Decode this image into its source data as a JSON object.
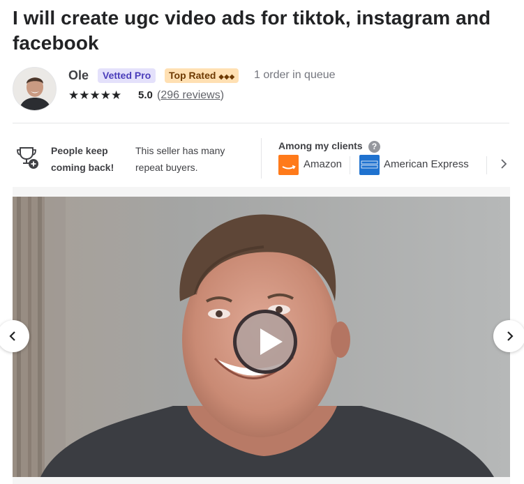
{
  "gig": {
    "title": "I will create ugc video ads for tiktok, instagram and facebook"
  },
  "seller": {
    "name": "Ole",
    "badge_vetted": "Vetted Pro",
    "badge_top_rated": "Top Rated",
    "badge_top_rated_suffix": "◆◆◆",
    "queue": "1 order in queue",
    "stars_icon": "★★★★★",
    "rating": "5.0",
    "reviews_open": "(",
    "reviews_link": "296 reviews",
    "reviews_close": ")"
  },
  "highlight": {
    "icon": "trophy-icon",
    "title": "People keep coming back!",
    "description": "This seller has many repeat buyers."
  },
  "clients": {
    "title": "Among my clients",
    "help": "?",
    "items": [
      {
        "name": "Amazon",
        "color": "#ff7a1a",
        "icon": "amazon-logo"
      },
      {
        "name": "American Express",
        "color": "#1f72cf",
        "icon": "amex-logo"
      }
    ],
    "next_icon": "chevron-right-icon"
  },
  "gallery": {
    "play_icon": "play-icon",
    "prev_icon": "chevron-left-icon",
    "next_icon": "chevron-right-icon"
  }
}
